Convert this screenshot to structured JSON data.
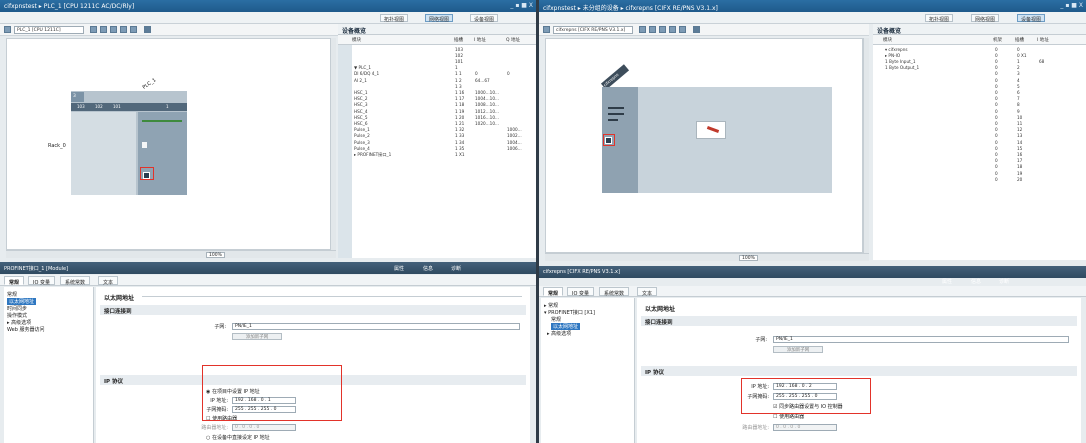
{
  "left": {
    "title": "cifxpnstest ▸ PLC_1 [CPU 1211C AC/DC/Rly]",
    "window_controls": "_ ▪ ■ X",
    "views": {
      "topology": "拓扑视图",
      "network": "网络视图",
      "device": "设备视图"
    },
    "device_select": "PLC_1 [CPU 1211C]",
    "rack_label": "Rack_0",
    "plc_label": "PLC_1",
    "slot_numbers": [
      "103",
      "102",
      "101",
      "1"
    ],
    "slot_top": "3",
    "zoom": "100%",
    "overview": {
      "title": "设备概览",
      "cols": {
        "module": "模块",
        "slot": "插槽",
        "i_addr": "I 地址",
        "q_addr": "Q 地址"
      },
      "rows": [
        {
          "module": "",
          "slot": "103",
          "i": "",
          "q": ""
        },
        {
          "module": "",
          "slot": "102",
          "i": "",
          "q": ""
        },
        {
          "module": "",
          "slot": "101",
          "i": "",
          "q": ""
        },
        {
          "module": "▼ PLC_1",
          "slot": "1",
          "i": "",
          "q": ""
        },
        {
          "module": "DI 6/DQ 4_1",
          "slot": "1 1",
          "i": "0",
          "q": "0"
        },
        {
          "module": "AI 2_1",
          "slot": "1 2",
          "i": "64...67",
          "q": ""
        },
        {
          "module": "",
          "slot": "1 3",
          "i": "",
          "q": ""
        },
        {
          "module": "HSC_1",
          "slot": "1 16",
          "i": "1000...10...",
          "q": ""
        },
        {
          "module": "HSC_2",
          "slot": "1 17",
          "i": "1004...10...",
          "q": ""
        },
        {
          "module": "HSC_3",
          "slot": "1 18",
          "i": "1008...10...",
          "q": ""
        },
        {
          "module": "HSC_4",
          "slot": "1 19",
          "i": "1012...10...",
          "q": ""
        },
        {
          "module": "HSC_5",
          "slot": "1 20",
          "i": "1016...10...",
          "q": ""
        },
        {
          "module": "HSC_6",
          "slot": "1 21",
          "i": "1020...10...",
          "q": ""
        },
        {
          "module": "Pulse_1",
          "slot": "1 32",
          "i": "",
          "q": "1000..."
        },
        {
          "module": "Pulse_2",
          "slot": "1 33",
          "i": "",
          "q": "1002..."
        },
        {
          "module": "Pulse_3",
          "slot": "1 34",
          "i": "",
          "q": "1004..."
        },
        {
          "module": "Pulse_4",
          "slot": "1 35",
          "i": "",
          "q": "1006..."
        },
        {
          "module": "▸ PROFINET接口_1",
          "slot": "1 X1",
          "i": "",
          "q": ""
        }
      ]
    },
    "props": {
      "module_title": "PROFINET接口_1 [Module]",
      "right_tabs": {
        "props": "属性",
        "info": "信息",
        "diag": "诊断"
      },
      "tabs": [
        "常规",
        "IO 变量",
        "系统常数",
        "文本"
      ],
      "nav": [
        "常规",
        "以太网地址",
        "时间同步",
        "操作模式",
        "▸ 高级选项",
        "Web 服务器访问"
      ],
      "section": "以太网地址",
      "sub_interface": "接口连接到",
      "subnet_label": "子网:",
      "subnet_value": "PN/IE_1",
      "add_subnet": "添加新子网",
      "ip_section": "IP 协议",
      "radio_set_project": "在项目中设置 IP 地址",
      "ip_label": "IP 地址:",
      "ip_value": "192 . 168 . 0 . 1",
      "mask_label": "子网掩码:",
      "mask_value": "255 . 255 . 255 . 0",
      "use_router": "使用路由器",
      "router_label": "路由器地址:",
      "router_value": "0 . 0 . 0 . 0",
      "radio_set_device": "在设备中直接设定 IP 地址"
    }
  },
  "right": {
    "title": "cifxpnstest ▸ 未分组的设备 ▸ cifxrepns [CIFX RE/PNS V3.1.x]",
    "window_controls": "_ ▪ ■ X",
    "views": {
      "topology": "拓扑视图",
      "network": "网络视图",
      "device": "设备视图"
    },
    "device_select": "cifxrepns [CIFX RE/PNS V3.1.x]",
    "device_label": "cifxrepns",
    "zoom": "100%",
    "overview": {
      "title": "设备概览",
      "cols": {
        "module": "模块",
        "rack": "机架",
        "slot": "插槽",
        "i_addr": "I 地址"
      },
      "rows": [
        {
          "module": "▾ cifxrepns",
          "rack": "0",
          "slot": "0",
          "i": ""
        },
        {
          "module": "▸ PN-IO",
          "rack": "0",
          "slot": "0 X1",
          "i": ""
        },
        {
          "module": "1 Byte Input_1",
          "rack": "0",
          "slot": "1",
          "i": "68"
        },
        {
          "module": "1 Byte Output_1",
          "rack": "0",
          "slot": "2",
          "i": ""
        },
        {
          "module": "",
          "rack": "0",
          "slot": "3",
          "i": ""
        },
        {
          "module": "",
          "rack": "0",
          "slot": "4",
          "i": ""
        },
        {
          "module": "",
          "rack": "0",
          "slot": "5",
          "i": ""
        },
        {
          "module": "",
          "rack": "0",
          "slot": "6",
          "i": ""
        },
        {
          "module": "",
          "rack": "0",
          "slot": "7",
          "i": ""
        },
        {
          "module": "",
          "rack": "0",
          "slot": "8",
          "i": ""
        },
        {
          "module": "",
          "rack": "0",
          "slot": "9",
          "i": ""
        },
        {
          "module": "",
          "rack": "0",
          "slot": "10",
          "i": ""
        },
        {
          "module": "",
          "rack": "0",
          "slot": "11",
          "i": ""
        },
        {
          "module": "",
          "rack": "0",
          "slot": "12",
          "i": ""
        },
        {
          "module": "",
          "rack": "0",
          "slot": "13",
          "i": ""
        },
        {
          "module": "",
          "rack": "0",
          "slot": "14",
          "i": ""
        },
        {
          "module": "",
          "rack": "0",
          "slot": "15",
          "i": ""
        },
        {
          "module": "",
          "rack": "0",
          "slot": "16",
          "i": ""
        },
        {
          "module": "",
          "rack": "0",
          "slot": "17",
          "i": ""
        },
        {
          "module": "",
          "rack": "0",
          "slot": "18",
          "i": ""
        },
        {
          "module": "",
          "rack": "0",
          "slot": "19",
          "i": ""
        },
        {
          "module": "",
          "rack": "0",
          "slot": "20",
          "i": ""
        }
      ]
    },
    "props": {
      "module_title": "cifxrepns [CIFX RE/PNS V3.1.x]",
      "right_tabs": {
        "props": "属性",
        "info": "信息",
        "diag": "诊断"
      },
      "tabs": [
        "常规",
        "IO 变量",
        "系统常数",
        "文本"
      ],
      "nav": [
        "▸ 常规",
        "▾ PROFINET接口 [X1]",
        "常规",
        "以太网地址",
        "▸ 高级选项"
      ],
      "section": "以太网地址",
      "sub_interface": "接口连接到",
      "subnet_label": "子网:",
      "subnet_value": "PN/IE_1",
      "add_subnet": "添加新子网",
      "ip_section": "IP 协议",
      "ip_label": "IP 地址:",
      "ip_value": "192 . 168 . 0 . 2",
      "mask_label": "子网掩码:",
      "mask_value": "255 . 255 . 255 . 0",
      "sync_router": "同步路由器设置与 IO 控制器",
      "use_router": "使用路由器",
      "router_label": "路由器地址:",
      "router_value": "0 . 0 . 0 . 0"
    }
  },
  "colors": {
    "highlight_box": "#e2332a",
    "titlebar": "#1f5a8b",
    "selection": "#2e77c1"
  }
}
